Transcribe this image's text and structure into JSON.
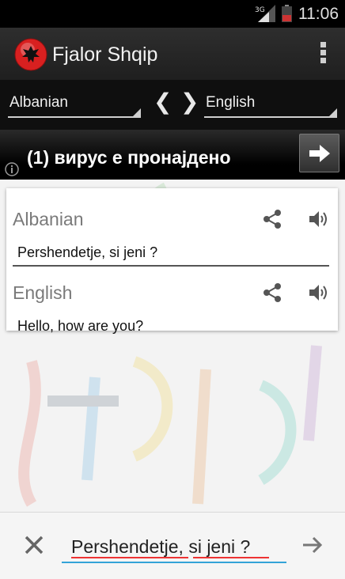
{
  "status_bar": {
    "time": "11:06",
    "network": "3G"
  },
  "app": {
    "title": "Fjalor Shqip",
    "logo": "albania-flag-eagle"
  },
  "languages": {
    "from": "Albanian",
    "to": "English",
    "swap_left": "❮",
    "swap_right": "❯"
  },
  "ad": {
    "text": "(1) вирус е пронајдено",
    "info_icon": "info-icon",
    "action_icon": "arrow-right-icon"
  },
  "card": {
    "source_label": "Albanian",
    "source_text": "Pershendetje, si jeni ?",
    "target_label": "English",
    "target_text": "Hello, how are you?"
  },
  "input": {
    "value": "Pershendetje, si jeni ?"
  },
  "colors": {
    "accent": "#33a3d8",
    "flag_red": "#d82020",
    "spell_error": "#ee3333"
  }
}
